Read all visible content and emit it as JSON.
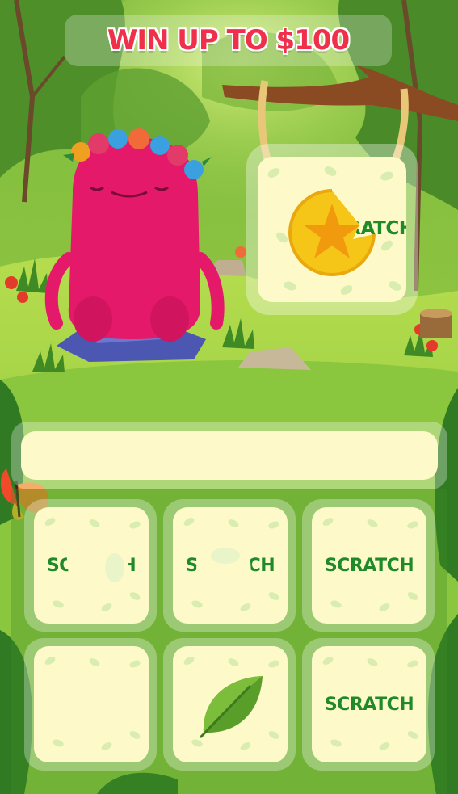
{
  "header": {
    "title": "WIN UP TO $100"
  },
  "hanging_card": {
    "label": "SCRATCH",
    "icon": "star-coin-icon"
  },
  "prize_bar": {
    "text": ""
  },
  "cards": [
    {
      "id": "card-1",
      "label": "SCRATCH",
      "state": "partially-scratched"
    },
    {
      "id": "card-2",
      "label": "SCRATCH",
      "state": "partially-scratched"
    },
    {
      "id": "card-3",
      "label": "SCRATCH",
      "state": "unscratched"
    },
    {
      "id": "card-4",
      "label": "",
      "state": "revealed-empty"
    },
    {
      "id": "card-5",
      "label": "",
      "state": "revealed-leaf",
      "icon": "leaf-icon"
    },
    {
      "id": "card-6",
      "label": "SCRATCH",
      "state": "unscratched"
    }
  ],
  "colors": {
    "title": "#f0304a",
    "scratch_text": "#1f8a2a",
    "card_face": "#fdf9c9",
    "grass": "#8cc63f",
    "monster": "#e5196a"
  }
}
